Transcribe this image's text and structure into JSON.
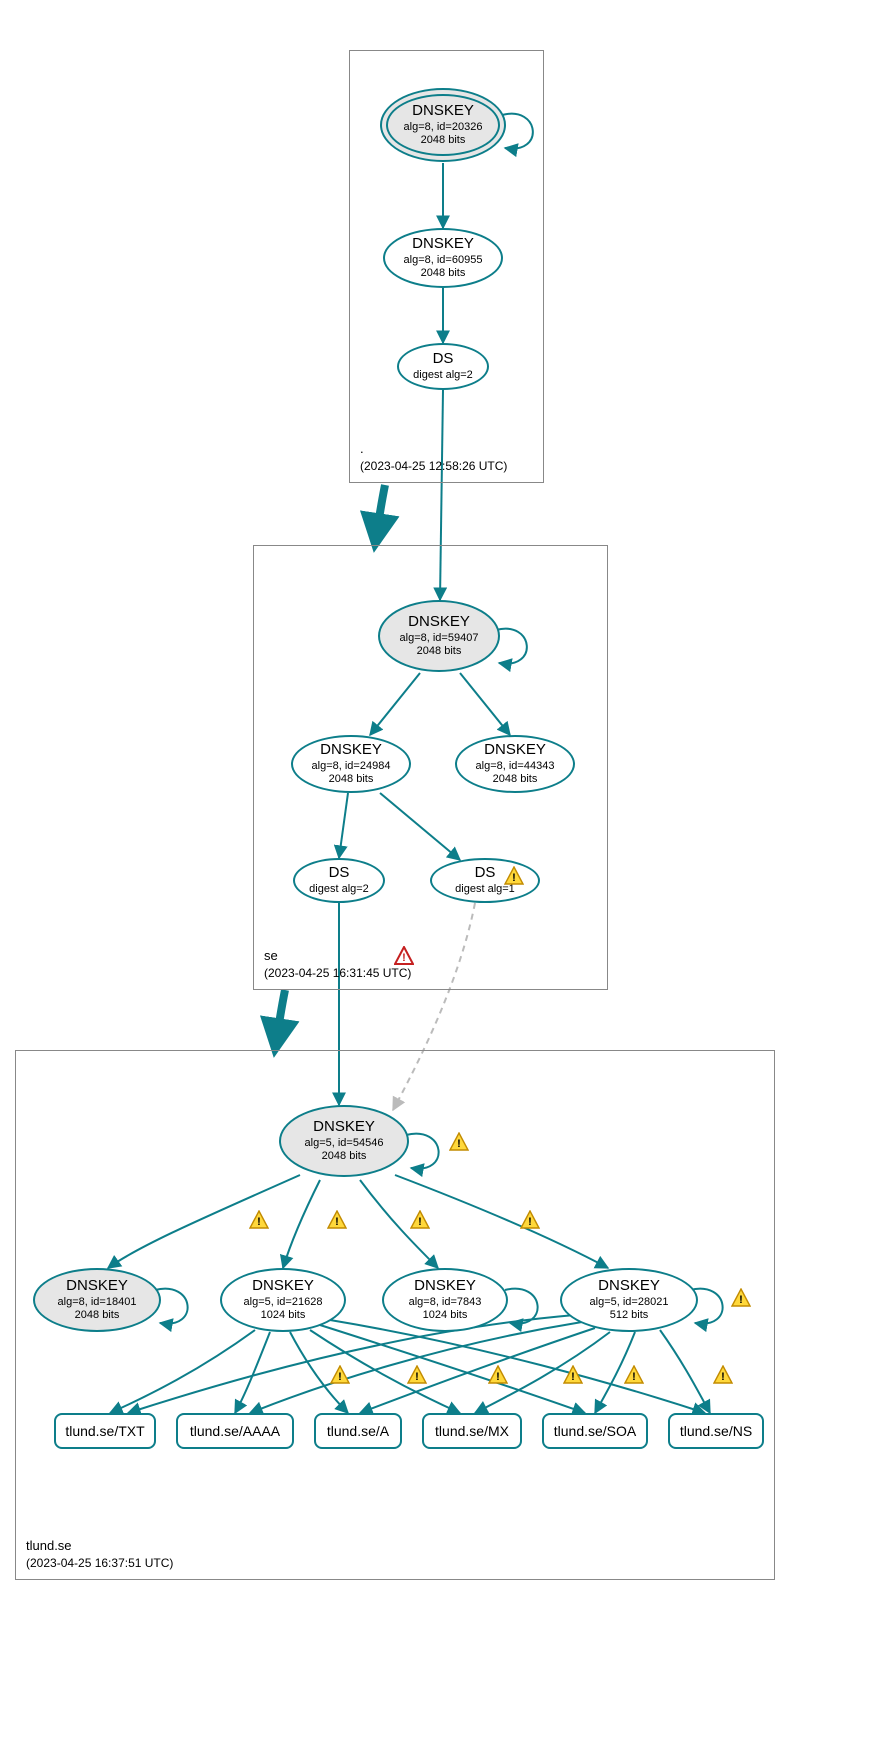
{
  "zones": {
    "root": {
      "title": ".",
      "timestamp": "(2023-04-25 12:58:26 UTC)"
    },
    "se": {
      "title": "se",
      "timestamp": "(2023-04-25 16:31:45 UTC)"
    },
    "tlund": {
      "title": "tlund.se",
      "timestamp": "(2023-04-25 16:37:51 UTC)"
    }
  },
  "nodes": {
    "root_ksk": {
      "title": "DNSKEY",
      "detail": "alg=8, id=20326",
      "bits": "2048 bits"
    },
    "root_zsk": {
      "title": "DNSKEY",
      "detail": "alg=8, id=60955",
      "bits": "2048 bits"
    },
    "root_ds": {
      "title": "DS",
      "detail": "digest alg=2"
    },
    "se_ksk": {
      "title": "DNSKEY",
      "detail": "alg=8, id=59407",
      "bits": "2048 bits"
    },
    "se_zsk": {
      "title": "DNSKEY",
      "detail": "alg=8, id=24984",
      "bits": "2048 bits"
    },
    "se_ext": {
      "title": "DNSKEY",
      "detail": "alg=8, id=44343",
      "bits": "2048 bits"
    },
    "se_ds2": {
      "title": "DS",
      "detail": "digest alg=2"
    },
    "se_ds1": {
      "title": "DS",
      "detail": "digest alg=1"
    },
    "tl_ksk": {
      "title": "DNSKEY",
      "detail": "alg=5, id=54546",
      "bits": "2048 bits"
    },
    "tl_k1": {
      "title": "DNSKEY",
      "detail": "alg=8, id=18401",
      "bits": "2048 bits"
    },
    "tl_k2": {
      "title": "DNSKEY",
      "detail": "alg=5, id=21628",
      "bits": "1024 bits"
    },
    "tl_k3": {
      "title": "DNSKEY",
      "detail": "alg=8, id=7843",
      "bits": "1024 bits"
    },
    "tl_k4": {
      "title": "DNSKEY",
      "detail": "alg=5, id=28021",
      "bits": "512 bits"
    }
  },
  "records": {
    "txt": "tlund.se/TXT",
    "aaaa": "tlund.se/AAAA",
    "a": "tlund.se/A",
    "mx": "tlund.se/MX",
    "soa": "tlund.se/SOA",
    "ns": "tlund.se/NS"
  },
  "chart_data": {
    "type": "graph",
    "title": "DNSSEC authentication / delegation graph for tlund.se",
    "zones": [
      {
        "name": ".",
        "timestamp": "2023-04-25 12:58:26 UTC"
      },
      {
        "name": "se",
        "timestamp": "2023-04-25 16:31:45 UTC",
        "status": "error"
      },
      {
        "name": "tlund.se",
        "timestamp": "2023-04-25 16:37:51 UTC"
      }
    ],
    "nodes": [
      {
        "id": "root_ksk",
        "zone": ".",
        "type": "DNSKEY",
        "alg": 8,
        "key_id": 20326,
        "bits": 2048,
        "ksk": true,
        "trust_anchor": true
      },
      {
        "id": "root_zsk",
        "zone": ".",
        "type": "DNSKEY",
        "alg": 8,
        "key_id": 60955,
        "bits": 2048
      },
      {
        "id": "root_ds",
        "zone": ".",
        "type": "DS",
        "digest_alg": 2
      },
      {
        "id": "se_ksk",
        "zone": "se",
        "type": "DNSKEY",
        "alg": 8,
        "key_id": 59407,
        "bits": 2048,
        "ksk": true
      },
      {
        "id": "se_zsk",
        "zone": "se",
        "type": "DNSKEY",
        "alg": 8,
        "key_id": 24984,
        "bits": 2048
      },
      {
        "id": "se_ext",
        "zone": "se",
        "type": "DNSKEY",
        "alg": 8,
        "key_id": 44343,
        "bits": 2048
      },
      {
        "id": "se_ds2",
        "zone": "se",
        "type": "DS",
        "digest_alg": 2
      },
      {
        "id": "se_ds1",
        "zone": "se",
        "type": "DS",
        "digest_alg": 1,
        "status": "warning"
      },
      {
        "id": "tl_ksk",
        "zone": "tlund.se",
        "type": "DNSKEY",
        "alg": 5,
        "key_id": 54546,
        "bits": 2048,
        "ksk": true,
        "status": "warning"
      },
      {
        "id": "tl_k1",
        "zone": "tlund.se",
        "type": "DNSKEY",
        "alg": 8,
        "key_id": 18401,
        "bits": 2048,
        "ksk": true,
        "status": "warning"
      },
      {
        "id": "tl_k2",
        "zone": "tlund.se",
        "type": "DNSKEY",
        "alg": 5,
        "key_id": 21628,
        "bits": 1024,
        "status": "warning"
      },
      {
        "id": "tl_k3",
        "zone": "tlund.se",
        "type": "DNSKEY",
        "alg": 8,
        "key_id": 7843,
        "bits": 1024,
        "status": "warning"
      },
      {
        "id": "tl_k4",
        "zone": "tlund.se",
        "type": "DNSKEY",
        "alg": 5,
        "key_id": 28021,
        "bits": 512,
        "status": "warning"
      },
      {
        "id": "rr_txt",
        "zone": "tlund.se",
        "type": "RRset",
        "name": "tlund.se/TXT"
      },
      {
        "id": "rr_aaaa",
        "zone": "tlund.se",
        "type": "RRset",
        "name": "tlund.se/AAAA"
      },
      {
        "id": "rr_a",
        "zone": "tlund.se",
        "type": "RRset",
        "name": "tlund.se/A"
      },
      {
        "id": "rr_mx",
        "zone": "tlund.se",
        "type": "RRset",
        "name": "tlund.se/MX"
      },
      {
        "id": "rr_soa",
        "zone": "tlund.se",
        "type": "RRset",
        "name": "tlund.se/SOA"
      },
      {
        "id": "rr_ns",
        "zone": "tlund.se",
        "type": "RRset",
        "name": "tlund.se/NS"
      }
    ],
    "edges": [
      {
        "from": "root_ksk",
        "to": "root_ksk",
        "kind": "self-sign"
      },
      {
        "from": "root_ksk",
        "to": "root_zsk"
      },
      {
        "from": "root_zsk",
        "to": "root_ds"
      },
      {
        "from": "root_ds",
        "to": "se_ksk"
      },
      {
        "from": ".",
        "to": "se",
        "kind": "delegation"
      },
      {
        "from": "se_ksk",
        "to": "se_ksk",
        "kind": "self-sign"
      },
      {
        "from": "se_ksk",
        "to": "se_zsk"
      },
      {
        "from": "se_ksk",
        "to": "se_ext"
      },
      {
        "from": "se_zsk",
        "to": "se_ds2"
      },
      {
        "from": "se_zsk",
        "to": "se_ds1"
      },
      {
        "from": "se_ds2",
        "to": "tl_ksk"
      },
      {
        "from": "se_ds1",
        "to": "tl_ksk",
        "style": "dashed-gray"
      },
      {
        "from": "se",
        "to": "tlund.se",
        "kind": "delegation"
      },
      {
        "from": "tl_ksk",
        "to": "tl_ksk",
        "kind": "self-sign",
        "status": "warning"
      },
      {
        "from": "tl_ksk",
        "to": "tl_k1",
        "status": "warning"
      },
      {
        "from": "tl_ksk",
        "to": "tl_k2",
        "status": "warning"
      },
      {
        "from": "tl_ksk",
        "to": "tl_k3",
        "status": "warning"
      },
      {
        "from": "tl_ksk",
        "to": "tl_k4",
        "status": "warning"
      },
      {
        "from": "tl_k1",
        "to": "tl_k1",
        "kind": "self-sign"
      },
      {
        "from": "tl_k3",
        "to": "tl_k3",
        "kind": "self-sign"
      },
      {
        "from": "tl_k4",
        "to": "tl_k4",
        "kind": "self-sign",
        "status": "warning"
      },
      {
        "from": "tl_k2",
        "to": "rr_txt"
      },
      {
        "from": "tl_k2",
        "to": "rr_aaaa"
      },
      {
        "from": "tl_k2",
        "to": "rr_a"
      },
      {
        "from": "tl_k2",
        "to": "rr_mx"
      },
      {
        "from": "tl_k2",
        "to": "rr_soa"
      },
      {
        "from": "tl_k2",
        "to": "rr_ns"
      },
      {
        "from": "tl_k4",
        "to": "rr_txt",
        "status": "warning"
      },
      {
        "from": "tl_k4",
        "to": "rr_aaaa",
        "status": "warning"
      },
      {
        "from": "tl_k4",
        "to": "rr_a",
        "status": "warning"
      },
      {
        "from": "tl_k4",
        "to": "rr_mx",
        "status": "warning"
      },
      {
        "from": "tl_k4",
        "to": "rr_soa",
        "status": "warning"
      },
      {
        "from": "tl_k4",
        "to": "rr_ns",
        "status": "warning"
      }
    ]
  }
}
